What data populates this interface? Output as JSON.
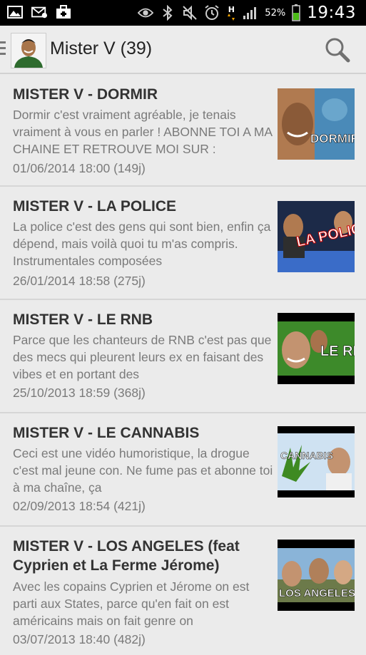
{
  "status_bar": {
    "battery": "52%",
    "time": "19:43",
    "network": "H",
    "icons": [
      "image-icon",
      "mail-icon",
      "briefcase-icon",
      "eye-icon",
      "bluetooth-icon",
      "mute-icon",
      "alarm-icon",
      "network-icon",
      "signal-icon",
      "battery-icon"
    ]
  },
  "app_bar": {
    "title": "Mister V (39)",
    "icons": [
      "menu-icon",
      "avatar",
      "search-icon"
    ]
  },
  "videos": [
    {
      "title": "MISTER V - DORMIR",
      "description": "Dormir c'est vraiment agréable, je tenais vraiment à vous en parler ! ABONNE TOI A MA CHAINE ET RETROUVE MOI SUR :",
      "date": "01/06/2014 18:00 (149j)",
      "thumb_label": "DORMIR"
    },
    {
      "title": "MISTER V - LA POLICE",
      "description": "La police c'est des gens qui sont bien, enfin ça dépend, mais voilà quoi tu m'as compris. Instrumentales composées",
      "date": "26/01/2014 18:58 (275j)",
      "thumb_label": "LA POLICE"
    },
    {
      "title": "MISTER V - LE RNB",
      "description": "Parce que les chanteurs de RNB c'est pas que des mecs qui pleurent leurs ex en faisant des vibes et en portant des",
      "date": "25/10/2013 18:59 (368j)",
      "thumb_label": "LE RNB"
    },
    {
      "title": "MISTER V - LE CANNABIS",
      "description": "Ceci est une vidéo humoristique, la drogue c'est mal jeune con. Ne fume pas et abonne toi à ma chaîne, ça",
      "date": "02/09/2013 18:54 (421j)",
      "thumb_label": "CANNABIS"
    },
    {
      "title": "MISTER V - LOS ANGELES (feat Cyprien et La Ferme Jérome)",
      "description": "Avec les copains Cyprien et Jérome on est parti aux States, parce qu'en fait on est américains mais on fait genre on",
      "date": "03/07/2013 18:40 (482j)",
      "thumb_label": "LOS ANGELES"
    }
  ]
}
